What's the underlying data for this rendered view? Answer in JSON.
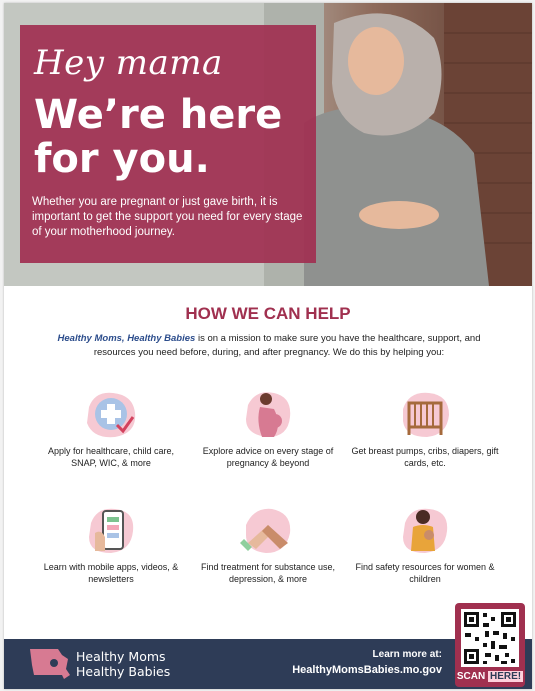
{
  "hero": {
    "script_line": "Hey mama",
    "headline": "We’re here for you.",
    "body": "Whether you are pregnant or just gave birth, it is important to get the support you need for every stage of your motherhood journey."
  },
  "help": {
    "title": "HOW WE CAN HELP",
    "intro_brand": "Healthy Moms, Healthy Babies",
    "intro_rest": " is on a mission to make sure you have the healthcare, support, and resources you need before, during, and after pregnancy. We do this by helping you:",
    "items": [
      {
        "icon": "medical-cross-icon",
        "caption": "Apply for healthcare, child care, SNAP, WIC, & more"
      },
      {
        "icon": "pregnant-woman-icon",
        "caption": "Explore advice on every stage of pregnancy & beyond"
      },
      {
        "icon": "crib-icon",
        "caption": "Get breast pumps, cribs, diapers, gift cards, etc."
      },
      {
        "icon": "mobile-phone-icon",
        "caption": "Learn with mobile apps, videos, & newsletters"
      },
      {
        "icon": "holding-hands-icon",
        "caption": "Find treatment for substance use, depression, & more"
      },
      {
        "icon": "mother-child-icon",
        "caption": "Find safety resources for women & children"
      }
    ]
  },
  "footer": {
    "logo_line1": "Healthy Moms",
    "logo_line2": "Healthy Babies",
    "learn_more": "Learn more at:",
    "url": "HealthyMomsBabies.mo.gov",
    "scan": "SCAN",
    "here": "HERE!"
  },
  "colors": {
    "accent": "#a0304f",
    "navy": "#2e3c57",
    "blush": "#f6c9d3",
    "brand_blue": "#2c4d8c"
  }
}
